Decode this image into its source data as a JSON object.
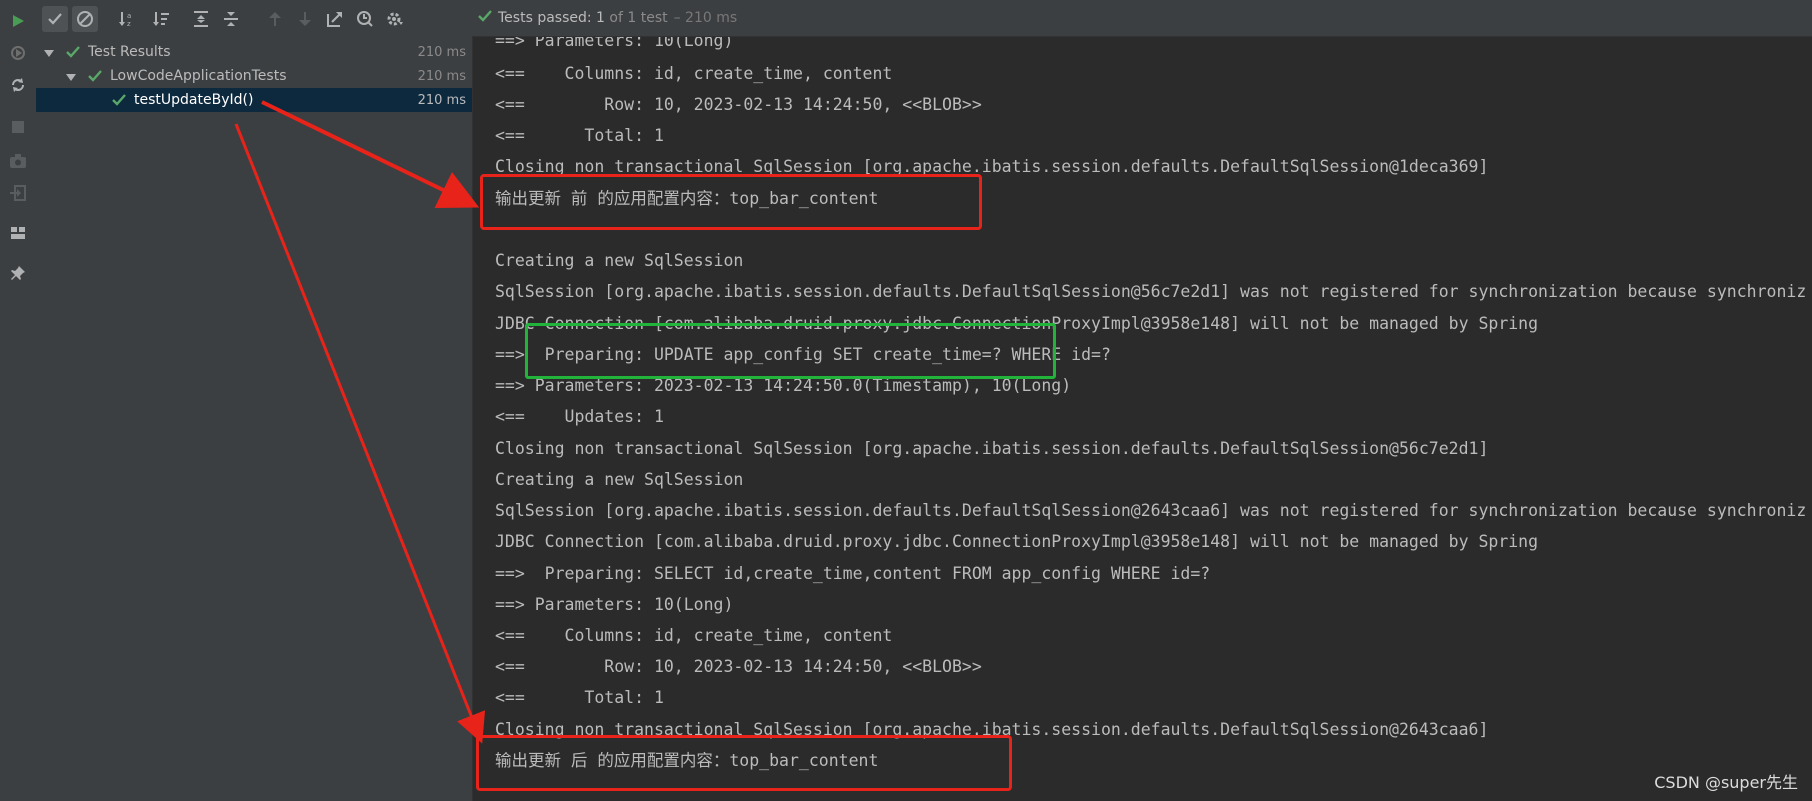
{
  "toolbar": {
    "items": [
      "run-icon",
      "check-icon",
      "cancel-icon",
      "sort-alpha-icon",
      "sort-duration-icon",
      "expand-all-icon",
      "collapse-all-icon",
      "prev-failed-icon",
      "next-failed-icon",
      "export-icon",
      "history-icon",
      "settings-icon"
    ]
  },
  "status": {
    "prefix": "Tests passed:",
    "count": "1",
    "of_text": "of 1 test",
    "duration": "– 210 ms"
  },
  "tree": {
    "root": {
      "label": "Test Results",
      "duration": "210 ms"
    },
    "suite": {
      "label": "LowCodeApplicationTests",
      "duration": "210 ms"
    },
    "test": {
      "label": "testUpdateById()",
      "duration": "210 ms"
    }
  },
  "console": {
    "lines": [
      "==> Parameters: 10(Long)",
      "<==    Columns: id, create_time, content",
      "<==        Row: 10, 2023-02-13 14:24:50, <<BLOB>>",
      "<==      Total: 1",
      "Closing non transactional SqlSession [org.apache.ibatis.session.defaults.DefaultSqlSession@1deca369]",
      "输出更新 前 的应用配置内容：top_bar_content",
      "",
      "Creating a new SqlSession",
      "SqlSession [org.apache.ibatis.session.defaults.DefaultSqlSession@56c7e2d1] was not registered for synchronization because synchroniz",
      "JDBC Connection [com.alibaba.druid.proxy.jdbc.ConnectionProxyImpl@3958e148] will not be managed by Spring",
      "==>  Preparing: UPDATE app_config SET create_time=? WHERE id=?",
      "==> Parameters: 2023-02-13 14:24:50.0(Timestamp), 10(Long)",
      "<==    Updates: 1",
      "Closing non transactional SqlSession [org.apache.ibatis.session.defaults.DefaultSqlSession@56c7e2d1]",
      "Creating a new SqlSession",
      "SqlSession [org.apache.ibatis.session.defaults.DefaultSqlSession@2643caa6] was not registered for synchronization because synchroniz",
      "JDBC Connection [com.alibaba.druid.proxy.jdbc.ConnectionProxyImpl@3958e148] will not be managed by Spring",
      "==>  Preparing: SELECT id,create_time,content FROM app_config WHERE id=?",
      "==> Parameters: 10(Long)",
      "<==    Columns: id, create_time, content",
      "<==        Row: 10, 2023-02-13 14:24:50, <<BLOB>>",
      "<==      Total: 1",
      "Closing non transactional SqlSession [org.apache.ibatis.session.defaults.DefaultSqlSession@2643caa6]",
      "输出更新 后 的应用配置内容：top_bar_content"
    ]
  },
  "watermark": "CSDN @super先生",
  "colors": {
    "pass_green": "#59a869",
    "annotation_red": "#e8231a",
    "annotation_green": "#22b43a",
    "selection": "#0d293e"
  }
}
